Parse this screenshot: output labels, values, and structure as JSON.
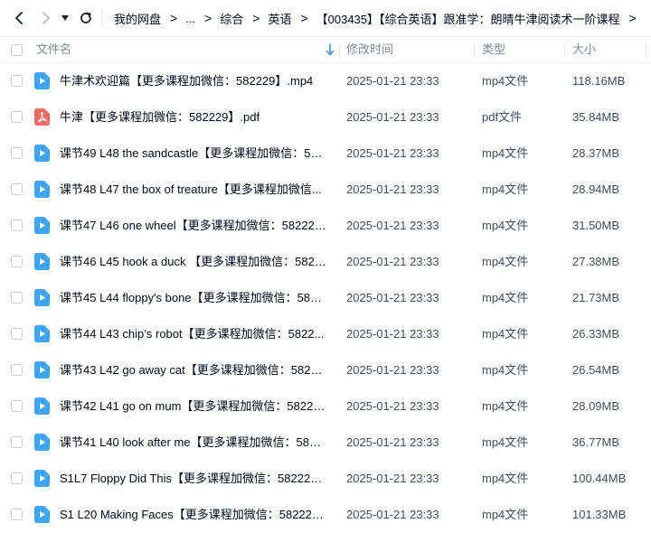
{
  "nav": {
    "breadcrumb": [
      "我的网盘",
      "...",
      "综合",
      "英语",
      "【003435】【综合英语】跟准学：朗晴牛津阅读术一阶课程"
    ],
    "separator": ">"
  },
  "table": {
    "headers": {
      "name": "文件名",
      "modified": "修改时间",
      "type": "类型",
      "size": "大小"
    },
    "rows": [
      {
        "name": "牛津术欢迎篇【更多课程加微信：582229】.mp4",
        "modified": "2025-01-21 23:33",
        "type": "mp4文件",
        "size": "118.16MB",
        "kind": "video"
      },
      {
        "name": "牛津【更多课程加微信：582229】.pdf",
        "modified": "2025-01-21 23:33",
        "type": "pdf文件",
        "size": "35.84MB",
        "kind": "pdf"
      },
      {
        "name": "课节49  L48 the sandcastle【更多课程加微信：582...",
        "modified": "2025-01-21 23:33",
        "type": "mp4文件",
        "size": "28.37MB",
        "kind": "video"
      },
      {
        "name": "课节48  L47 the box of treature【更多课程加微信...",
        "modified": "2025-01-21 23:33",
        "type": "mp4文件",
        "size": "28.94MB",
        "kind": "video"
      },
      {
        "name": "课节47  L46  one  wheel【更多课程加微信：582229...",
        "modified": "2025-01-21 23:33",
        "type": "mp4文件",
        "size": "31.50MB",
        "kind": "video"
      },
      {
        "name": "课节46  L45 hook a duck   【更多课程加微信：5822...",
        "modified": "2025-01-21 23:33",
        "type": "mp4文件",
        "size": "27.38MB",
        "kind": "video"
      },
      {
        "name": "课节45  L44  floppy's bone【更多课程加微信：5822...",
        "modified": "2025-01-21 23:33",
        "type": "mp4文件",
        "size": "21.73MB",
        "kind": "video"
      },
      {
        "name": "课节44  L43  chip’s robot【更多课程加微信：5822...",
        "modified": "2025-01-21 23:33",
        "type": "mp4文件",
        "size": "26.33MB",
        "kind": "video"
      },
      {
        "name": "课节43  L42 go away cat【更多课程加微信：58222...",
        "modified": "2025-01-21 23:33",
        "type": "mp4文件",
        "size": "26.54MB",
        "kind": "video"
      },
      {
        "name": "课节42  L41   go on mum【更多课程加微信：58222...",
        "modified": "2025-01-21 23:33",
        "type": "mp4文件",
        "size": "28.09MB",
        "kind": "video"
      },
      {
        "name": "课节41  L40  look after me【更多课程加微信：5822...",
        "modified": "2025-01-21 23:33",
        "type": "mp4文件",
        "size": "36.77MB",
        "kind": "video"
      },
      {
        "name": "S1L7 Floppy Did This【更多课程加微信：582229】....",
        "modified": "2025-01-21 23:33",
        "type": "mp4文件",
        "size": "100.44MB",
        "kind": "video"
      },
      {
        "name": "S1 L20 Making Faces【更多课程加微信：582229】....",
        "modified": "2025-01-21 23:33",
        "type": "mp4文件",
        "size": "101.33MB",
        "kind": "video"
      }
    ]
  },
  "colors": {
    "video_icon": "#3ea5f6",
    "pdf_icon": "#f26a64",
    "sort_arrow": "#3d8ff8"
  },
  "icons": {
    "back": "chevron-left-icon",
    "forward": "chevron-right-icon",
    "history": "caret-down-icon",
    "refresh": "refresh-icon",
    "sort": "sort-down-icon",
    "video": "video-file-icon",
    "pdf": "pdf-file-icon"
  }
}
